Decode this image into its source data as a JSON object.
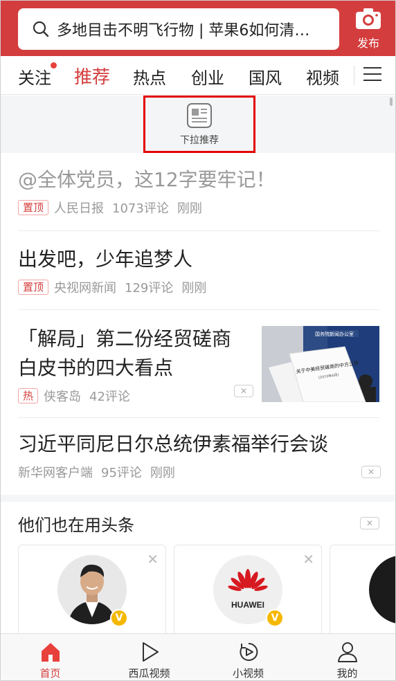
{
  "search": {
    "query": "多地目击不明飞行物 | 苹果6如何清…"
  },
  "publish": {
    "label": "发布"
  },
  "tabs": [
    {
      "label": "关注"
    },
    {
      "label": "推荐"
    },
    {
      "label": "热点"
    },
    {
      "label": "创业"
    },
    {
      "label": "国风"
    },
    {
      "label": "视频"
    }
  ],
  "pull": {
    "label": "下拉推荐"
  },
  "feed": [
    {
      "title": "@全体党员，这12字要牢记！",
      "tag": "置顶",
      "source": "人民日报",
      "comments": "1073评论",
      "time": "刚刚"
    },
    {
      "title": "出发吧，少年追梦人",
      "tag": "置顶",
      "source": "央视网新闻",
      "comments": "129评论",
      "time": "刚刚"
    },
    {
      "title": "「解局」第二份经贸磋商白皮书的四大看点",
      "tag": "热",
      "source": "侠客岛",
      "comments": "42评论",
      "time": ""
    },
    {
      "title": "习近平同尼日尔总统伊素福举行会谈",
      "tag": "",
      "source": "新华网客户端",
      "comments": "95评论",
      "time": "刚刚"
    }
  ],
  "thumbnail": {
    "text_top": "国务院新闻办公室",
    "doc_title": "关于中美经贸磋商的中方立场",
    "doc_sub": "(2019年6月)"
  },
  "recommend": {
    "title": "他们也在用头条",
    "cards": [
      {
        "name": "person"
      },
      {
        "name": "HUAWEI"
      },
      {
        "name": "person2"
      }
    ]
  },
  "bottom_nav": [
    {
      "label": "首页"
    },
    {
      "label": "西瓜视频"
    },
    {
      "label": "小视频"
    },
    {
      "label": "我的"
    }
  ],
  "colors": {
    "brand": "#d43d3d",
    "highlight_box": "#e30000"
  }
}
